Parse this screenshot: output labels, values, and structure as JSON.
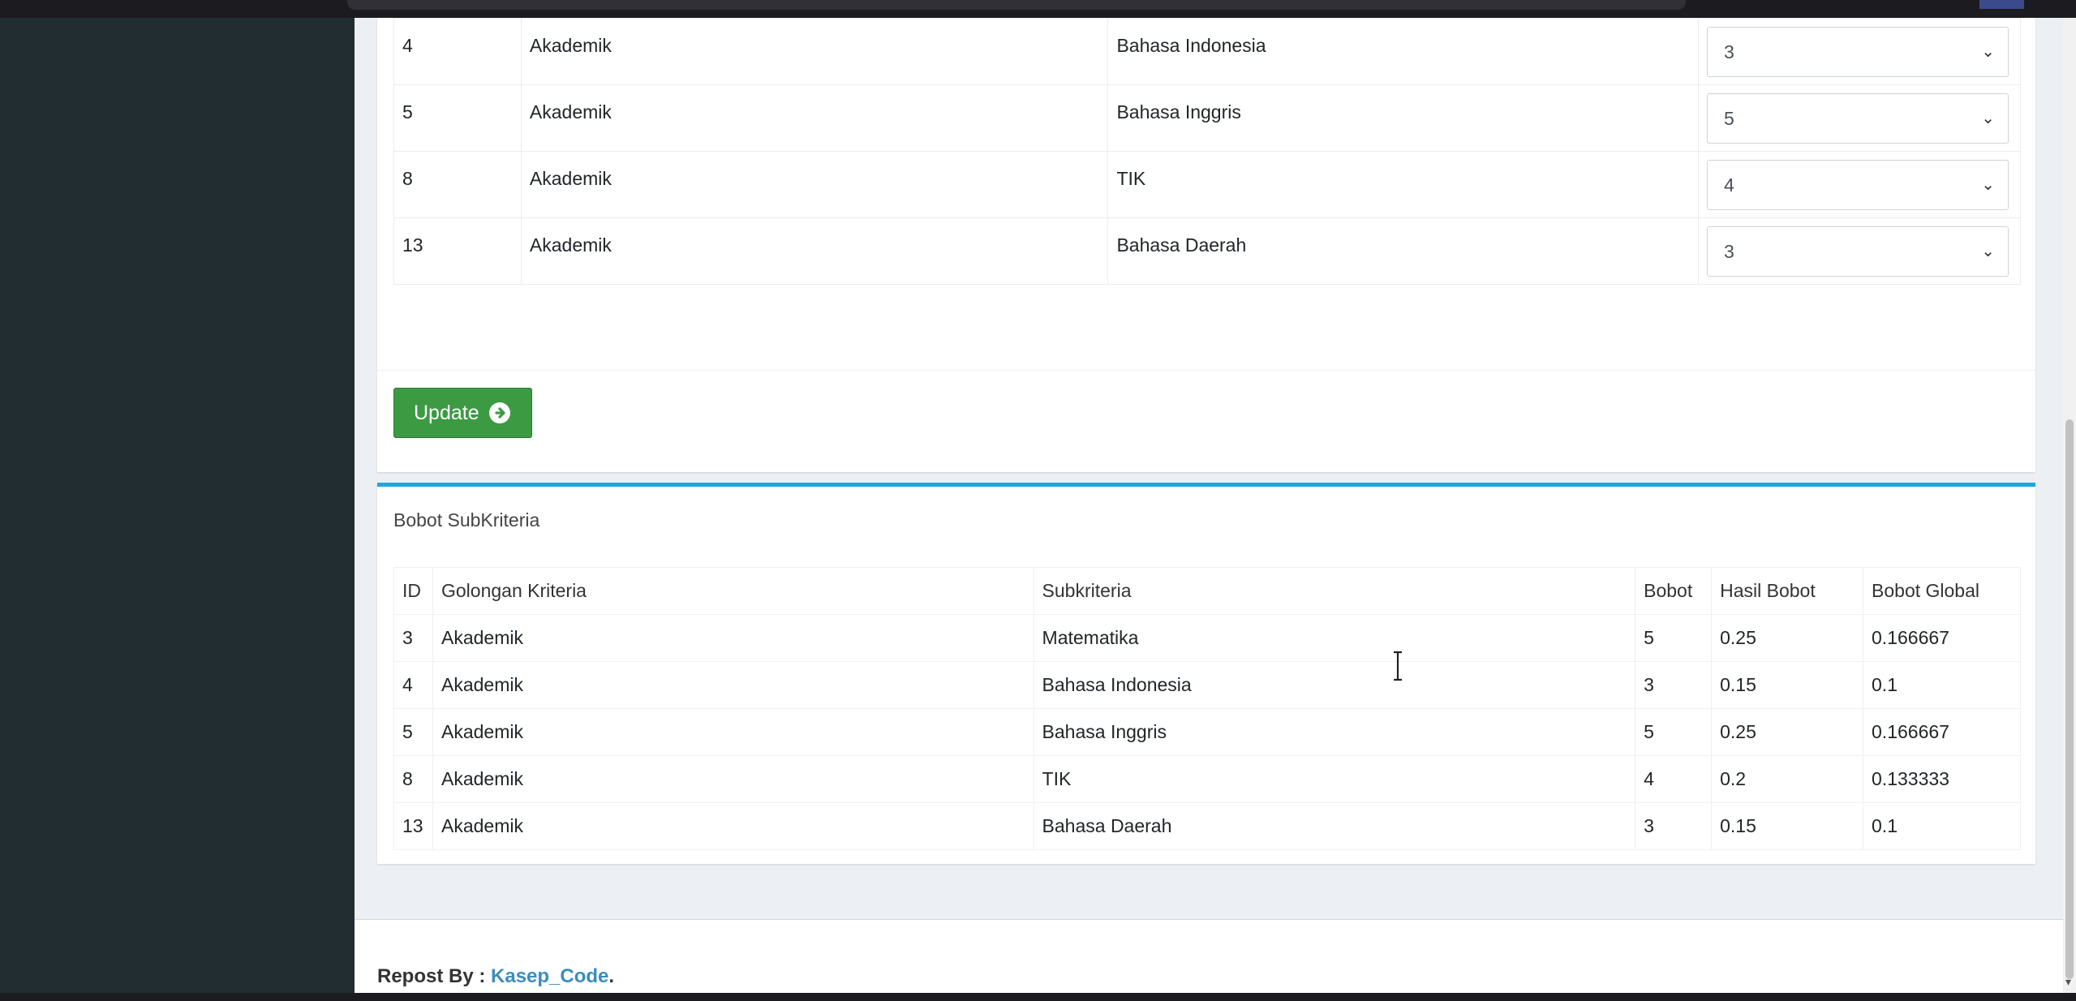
{
  "selection_table": {
    "rows": [
      {
        "id": "4",
        "golongan": "Akademik",
        "subkriteria": "Bahasa Indonesia",
        "value": "3"
      },
      {
        "id": "5",
        "golongan": "Akademik",
        "subkriteria": "Bahasa Inggris",
        "value": "5"
      },
      {
        "id": "8",
        "golongan": "Akademik",
        "subkriteria": "TIK",
        "value": "4"
      },
      {
        "id": "13",
        "golongan": "Akademik",
        "subkriteria": "Bahasa Daerah",
        "value": "3"
      }
    ]
  },
  "update_button": {
    "label": "Update"
  },
  "bobot_box": {
    "title": "Bobot SubKriteria",
    "headers": [
      "ID",
      "Golongan Kriteria",
      "Subkriteria",
      "Bobot",
      "Hasil Bobot",
      "Bobot Global"
    ],
    "rows": [
      [
        "3",
        "Akademik",
        "Matematika",
        "5",
        "0.25",
        "0.166667"
      ],
      [
        "4",
        "Akademik",
        "Bahasa Indonesia",
        "3",
        "0.15",
        "0.1"
      ],
      [
        "5",
        "Akademik",
        "Bahasa Inggris",
        "5",
        "0.25",
        "0.166667"
      ],
      [
        "8",
        "Akademik",
        "TIK",
        "4",
        "0.2",
        "0.133333"
      ],
      [
        "13",
        "Akademik",
        "Bahasa Daerah",
        "3",
        "0.15",
        "0.1"
      ]
    ]
  },
  "footer": {
    "prefix": "Repost By : ",
    "link": "Kasep_Code",
    "suffix": "."
  },
  "colors": {
    "sidebar": "#222d32",
    "content_bg": "#ecf0f5",
    "update_button": "#3c9a43",
    "box_accent": "#1fa6dd",
    "link": "#3c8dbc"
  }
}
